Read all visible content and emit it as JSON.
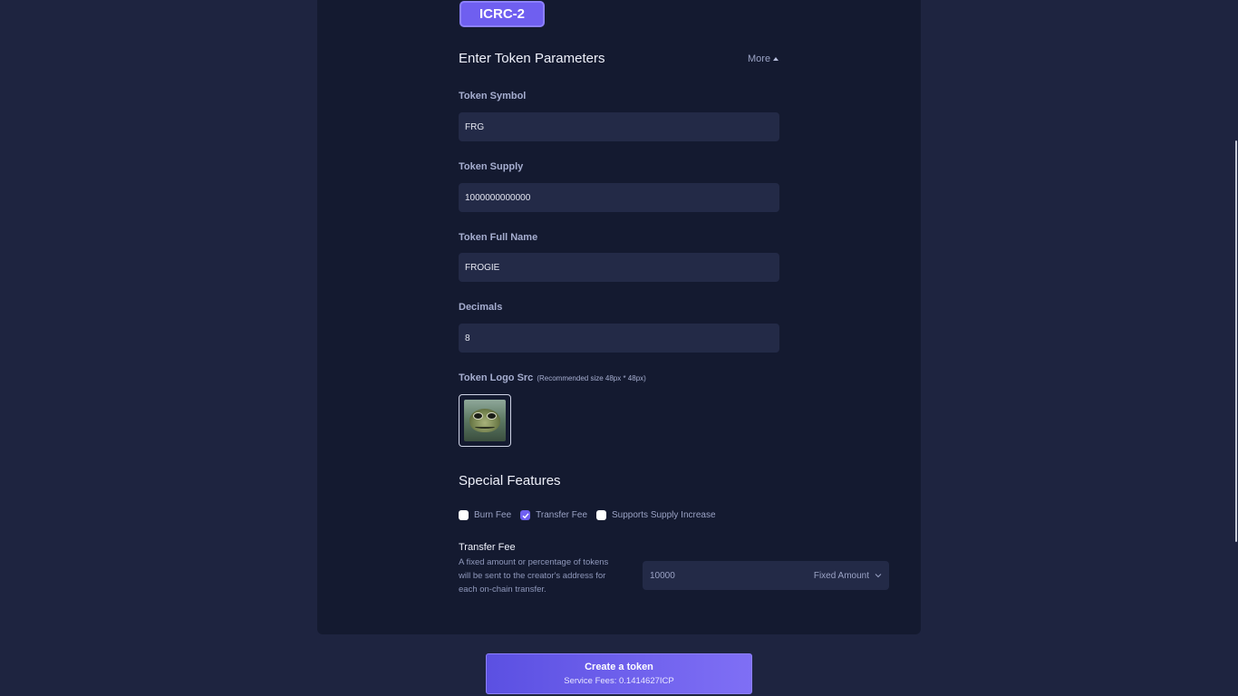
{
  "standard_tab": {
    "label": "ICRC-2"
  },
  "params": {
    "title": "Enter Token Parameters",
    "more_label": "More"
  },
  "fields": {
    "symbol": {
      "label": "Token Symbol",
      "value": "FRG"
    },
    "supply": {
      "label": "Token Supply",
      "value": "1000000000000"
    },
    "full_name": {
      "label": "Token Full Name",
      "value": "FROGIE"
    },
    "decimals": {
      "label": "Decimals",
      "value": "8"
    },
    "logo": {
      "label": "Token Logo Src",
      "hint": "(Recommended size 48px * 48px)"
    }
  },
  "special_features": {
    "title": "Special Features",
    "options": [
      {
        "label": "Burn Fee",
        "checked": false
      },
      {
        "label": "Transfer Fee",
        "checked": true
      },
      {
        "label": "Supports Supply Increase",
        "checked": false
      }
    ]
  },
  "transfer_fee": {
    "title": "Transfer Fee",
    "description": "A fixed amount or percentage of tokens will be sent to the creator's address for each on-chain transfer.",
    "value": "10000",
    "type": "Fixed Amount"
  },
  "create_button": {
    "label": "Create a token",
    "fees": "Service Fees: 0.1414627ICP"
  },
  "colors": {
    "accent": "#6f5ff0",
    "panel": "#141a30",
    "background": "#1e2440",
    "input": "#232a47"
  }
}
